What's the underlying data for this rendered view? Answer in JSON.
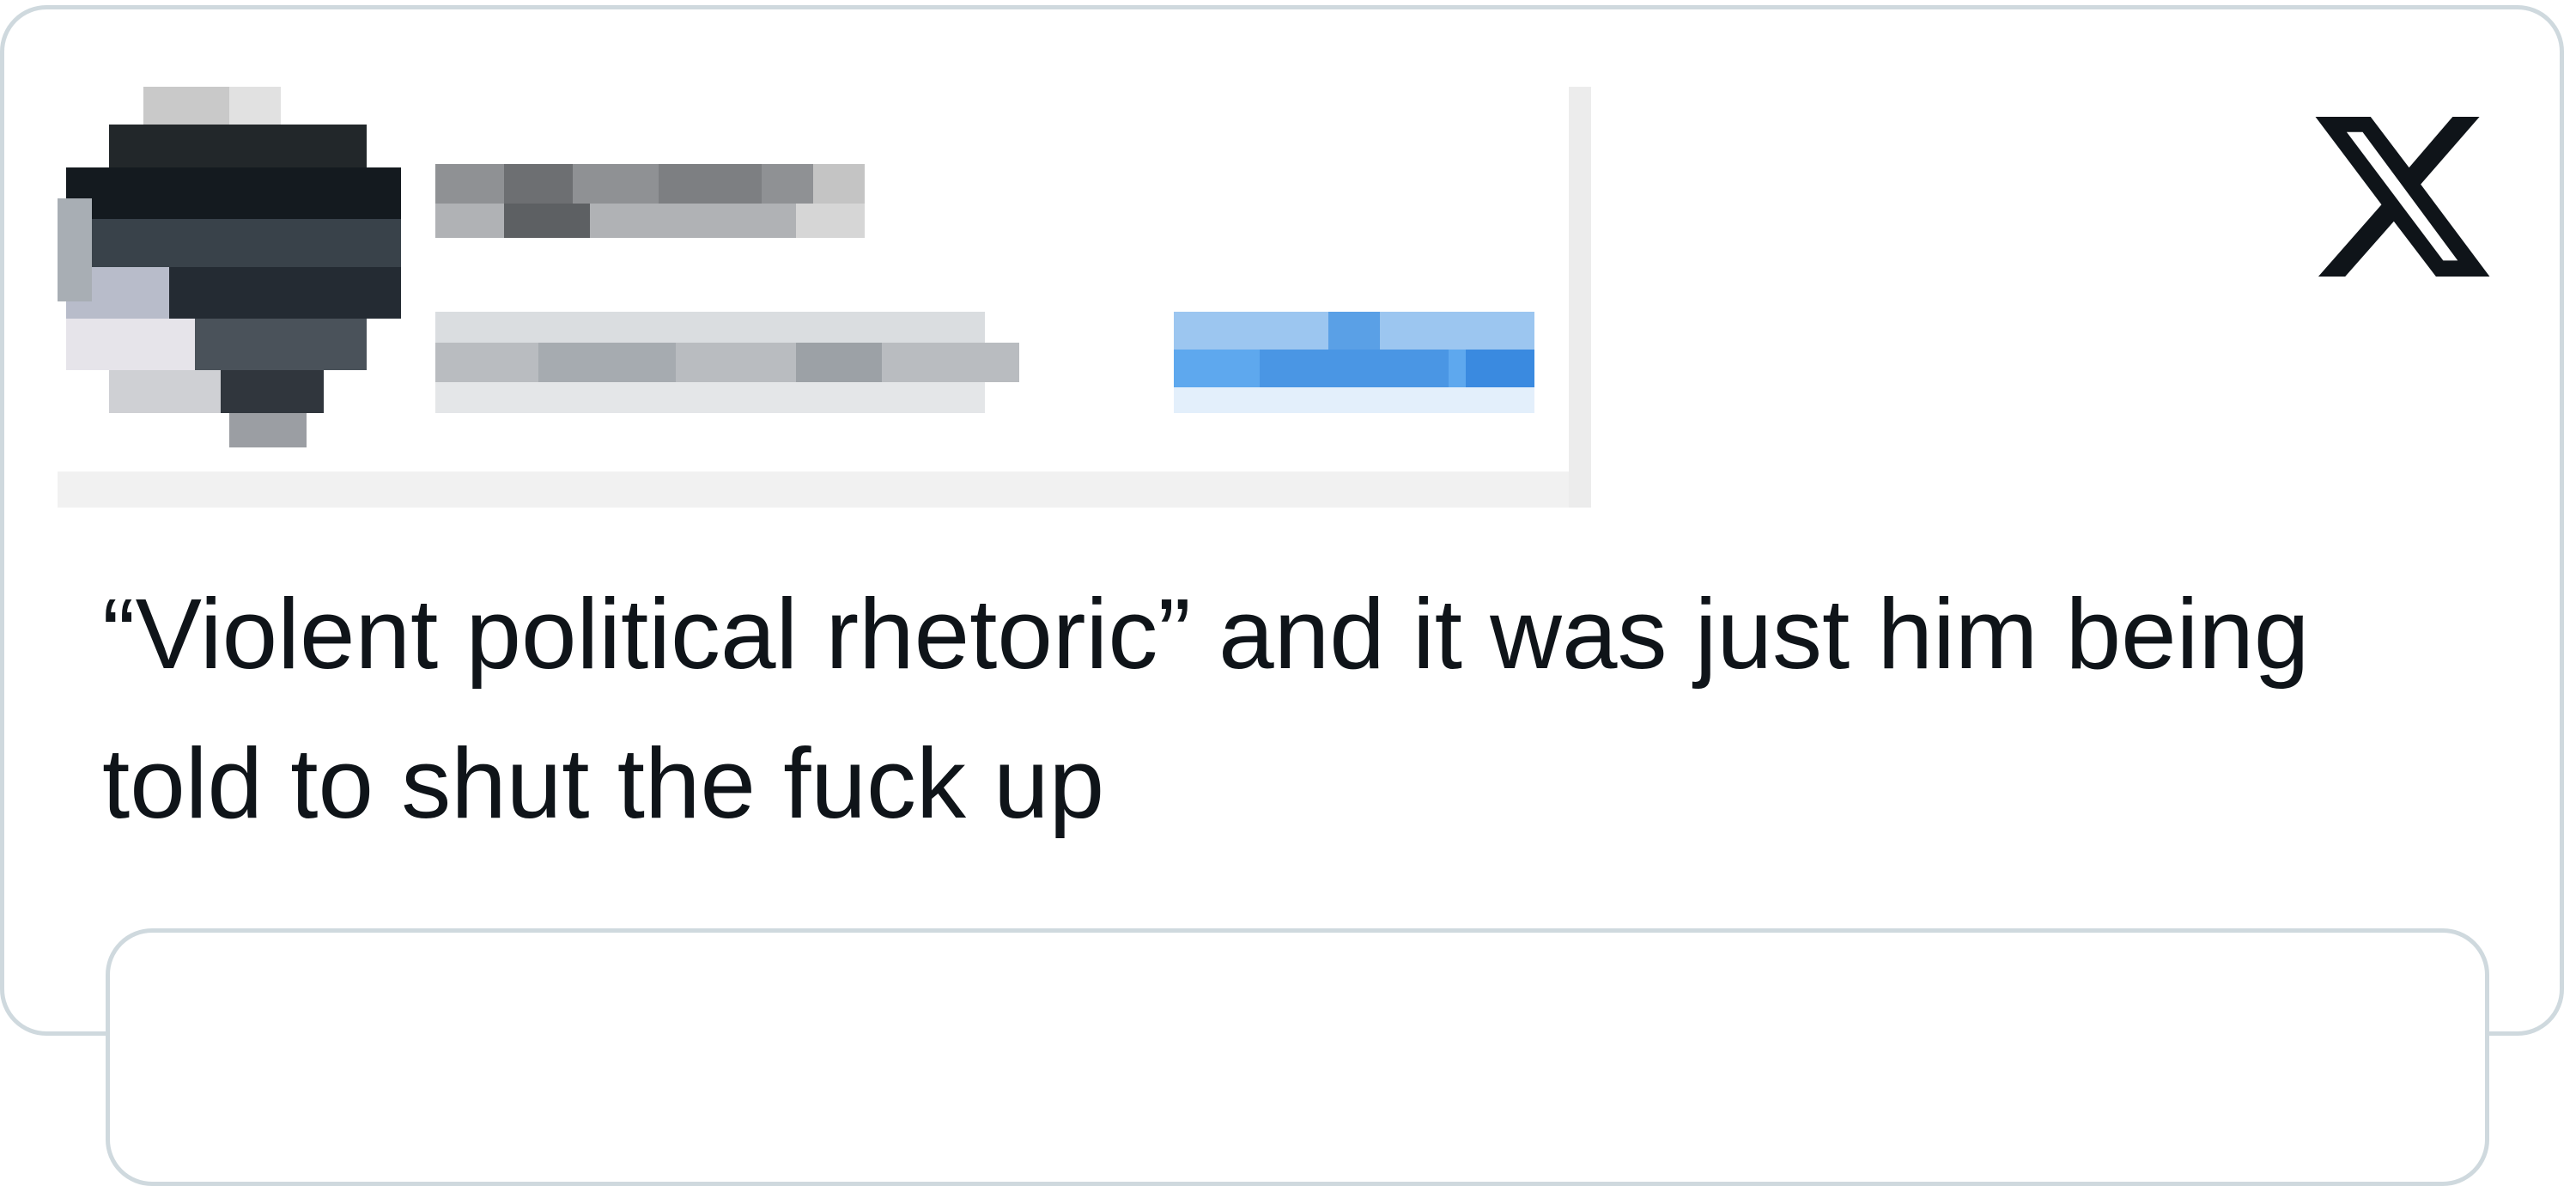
{
  "tweet": {
    "text": "“Violent political rhetoric” and it was just him being told to shut the fuck up",
    "platform_icon": "x-logo-icon",
    "author": {
      "avatar_icon": "pixelated-avatar",
      "display_name": "",
      "handle": "",
      "follow_link": ""
    }
  },
  "quoted_tweet": {
    "text": ""
  },
  "colors": {
    "text": "#0f1419",
    "border": "#cfd9de",
    "accent": "#1d9bf0"
  }
}
